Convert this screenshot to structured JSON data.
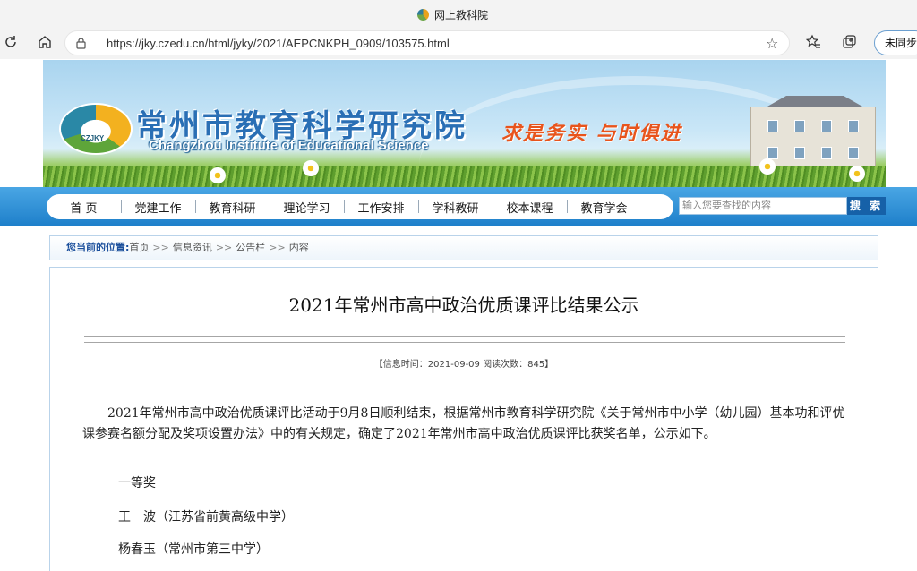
{
  "browser": {
    "tab_title": "网上教科院",
    "url": "https://jky.czedu.cn/html/jyky/2021/AEPCNKPH_0909/103575.html",
    "sync_label": "未同步",
    "icons": [
      "refresh-icon",
      "home-icon",
      "lock-icon",
      "add-favorite-icon",
      "favorites-icon",
      "collections-icon"
    ]
  },
  "banner": {
    "logo_abbr": "CZJKY",
    "site_name": "常州市教育科学研究院",
    "site_name_en": "Changzhou Institute of Educational Science",
    "slogan": "求是务实  与时俱进"
  },
  "nav": {
    "items": [
      "首  页",
      "党建工作",
      "教育科研",
      "理论学习",
      "工作安排",
      "学科教研",
      "校本课程",
      "教育学会"
    ],
    "search_placeholder": "输入您要查找的内容",
    "search_button": "搜 索"
  },
  "breadcrumb": {
    "label": "您当前的位置:",
    "items": [
      "首页",
      "信息资讯",
      "公告栏",
      "内容"
    ],
    "separator": ">>"
  },
  "article": {
    "title": "2021年常州市高中政治优质课评比结果公示",
    "meta": "【信息时间：2021-09-09    阅读次数：845】",
    "paragraph": "2021年常州市高中政治优质课评比活动于9月8日顺利结束，根据常州市教育科学研究院《关于常州市中小学（幼儿园）基本功和评优课参赛名额分配及奖项设置办法》中的有关规定，确定了2021年常州市高中政治优质课评比获奖名单，公示如下。",
    "award_heading": "一等奖",
    "winners": [
      "王　波（江苏省前黄高级中学）",
      "杨春玉（常州市第三中学）"
    ]
  },
  "colors": {
    "nav_blue": "#1d7fca",
    "site_name_blue": "#2a6fb5",
    "slogan_orange": "#e8541c",
    "breadcrumb_label": "#1b4f9c"
  }
}
